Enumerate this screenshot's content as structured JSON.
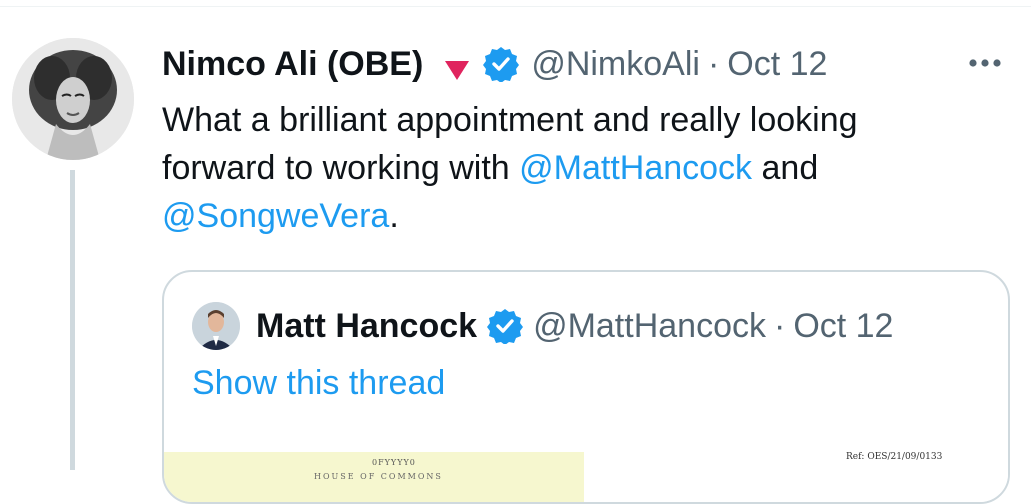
{
  "tweet": {
    "author": {
      "display_name": "Nimco Ali (OBE)",
      "handle": "@NimkoAli",
      "separator": "·",
      "date": "Oct 12"
    },
    "text_parts": {
      "line1": "What a brilliant appointment and really looking",
      "line2_prefix": "forward to working with ",
      "mention1": "@MattHancock",
      "line2_suffix": " and",
      "mention2": "@SongweVera",
      "line3_suffix": "."
    },
    "icons": {
      "badge": "red-triangle-icon",
      "verified": "verified-badge-icon",
      "more": "more-options-icon"
    }
  },
  "quote": {
    "display_name": "Matt Hancock",
    "handle": "@MattHancock",
    "separator": "·",
    "date": "Oct 12",
    "show_thread_label": "Show this thread",
    "document": {
      "ref_text": "Ref: OES/21/09/0133",
      "top_text": "0FYYYY0",
      "mid_text": "HOUSE OF COMMONS"
    }
  },
  "colors": {
    "link": "#1d9bf0",
    "muted": "#536471",
    "border": "#cfd9de",
    "verified": "#1d9bf0",
    "triangle": "#e0245e"
  }
}
